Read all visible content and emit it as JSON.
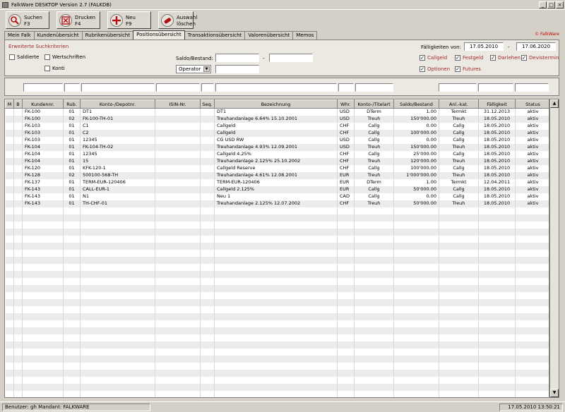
{
  "window": {
    "title": "FalkWare DESKTOP Version 2.7  (FALKDB)",
    "controls": [
      "_",
      "□",
      "×"
    ]
  },
  "toolbar": {
    "search": {
      "line1": "Suchen",
      "line2": "F3"
    },
    "print": {
      "line1": "Drucken",
      "line2": "F4"
    },
    "new": {
      "line1": "Neu",
      "line2": "F9"
    },
    "clear": {
      "line1": "Auswahl",
      "line2": "löschen"
    }
  },
  "tabs": [
    "Mein Falk",
    "Kundenübersicht",
    "Rubrikenübersicht",
    "Positionsübersicht",
    "Transaktionsübersicht",
    "Valorenübersicht",
    "Memos"
  ],
  "brand": "© FalkWare",
  "criteria": {
    "header": "Erweiterte Suchkriterien",
    "saldierte": "Saldierte",
    "wertschriften": "Wertschriften",
    "konti": "Konti",
    "saldo_label": "Saldo/Bestand:",
    "dash": "-",
    "operator": "Operator",
    "faellig_label": "Fälligkeiten von:",
    "date_from": "17.05.2010",
    "date_to": "17.06.2020",
    "callgeld": "Callgeld",
    "festgeld": "Festgeld",
    "darlehen": "Darlehen",
    "devistermin": "Devistermin",
    "optionen": "Optionen",
    "futures": "Futures"
  },
  "table": {
    "columns": [
      "M",
      "B",
      "Kundennr.",
      "Rub.",
      "Konto-/Depotnr.",
      "ISIN-Nr.",
      "Seq.",
      "Bezeichnung",
      "Whr.",
      "Konto-/Titelart",
      "Saldo/Bestand",
      "Anl.-kat.",
      "Fälligkeit",
      "Status"
    ],
    "rows": [
      [
        "",
        "",
        "FK-100",
        "01",
        "DT1",
        "",
        "",
        "DT1",
        "USD",
        "DTerm",
        "1.00",
        "Termkt",
        "31.12.2013",
        "aktiv"
      ],
      [
        "",
        "",
        "FK-100",
        "02",
        "FK-100-TH-01",
        "",
        "",
        "Treuhandanlage 6.64% 15.10.2001",
        "USD",
        "Treuh",
        "150'000.00",
        "Treuh",
        "18.05.2010",
        "aktiv"
      ],
      [
        "",
        "",
        "FK-103",
        "01",
        "C1",
        "",
        "",
        "Callgeld",
        "CHF",
        "Callg",
        "0.00",
        "Callg",
        "18.05.2010",
        "aktiv"
      ],
      [
        "",
        "",
        "FK-103",
        "01",
        "C2",
        "",
        "",
        "Callgeld",
        "CHF",
        "Callg",
        "100'000.00",
        "Callg",
        "18.05.2010",
        "aktiv"
      ],
      [
        "",
        "",
        "FK-103",
        "01",
        "12345",
        "",
        "",
        "CG USD RW",
        "USD",
        "Callg",
        "0.00",
        "Callg",
        "18.05.2010",
        "aktiv"
      ],
      [
        "",
        "",
        "FK-104",
        "01",
        "FK-104-TH-02",
        "",
        "",
        "Treuhandanlage 4.93% 12.09.2001",
        "USD",
        "Treuh",
        "150'000.00",
        "Treuh",
        "18.05.2010",
        "aktiv"
      ],
      [
        "",
        "",
        "FK-104",
        "01",
        "12345",
        "",
        "",
        "Callgeld 4.25%",
        "CHF",
        "Callg",
        "25'000.00",
        "Callg",
        "18.05.2010",
        "aktiv"
      ],
      [
        "",
        "",
        "FK-104",
        "01",
        "15",
        "",
        "",
        "Treuhandanlage 2.125% 25.10.2002",
        "CHF",
        "Treuh",
        "120'000.00",
        "Treuh",
        "18.05.2010",
        "aktiv"
      ],
      [
        "",
        "",
        "FK-120",
        "01",
        "KFK-120-1",
        "",
        "",
        "Callgeld Reserve",
        "CHF",
        "Callg",
        "100'000.00",
        "Callg",
        "18.05.2010",
        "aktiv"
      ],
      [
        "",
        "",
        "FK-128",
        "02",
        "500100-568-TH",
        "",
        "",
        "Treuhandanlage 4.61% 12.08.2001",
        "EUR",
        "Treuh",
        "1'000'000.00",
        "Treuh",
        "18.05.2010",
        "aktiv"
      ],
      [
        "",
        "",
        "FK-137",
        "01",
        "TERM-EUR-120406",
        "",
        "",
        "TERM-EUR-120406",
        "EUR",
        "DTerm",
        "1.00",
        "Termkt",
        "12.04.2011",
        "aktiv"
      ],
      [
        "",
        "",
        "FK-143",
        "01",
        "CALL-EUR-1",
        "",
        "",
        "Callgeld 2.125%",
        "EUR",
        "Callg",
        "50'000.00",
        "Callg",
        "18.05.2010",
        "aktiv"
      ],
      [
        "",
        "",
        "FK-143",
        "01",
        "N1",
        "",
        "",
        "Neu 1",
        "CAD",
        "Callg",
        "0.00",
        "Callg",
        "18.05.2010",
        "aktiv"
      ],
      [
        "",
        "",
        "FK-143",
        "01",
        "TH-CHF-01",
        "",
        "",
        "Treuhandanlage 2.125% 12.07.2002",
        "CHF",
        "Treuh",
        "50'000.00",
        "Treuh",
        "18.05.2010",
        "aktiv"
      ]
    ]
  },
  "status": {
    "user": "Benutzer: gh  Mandant: FALKWARE",
    "datetime": "17.05.2010 13:50:21"
  }
}
